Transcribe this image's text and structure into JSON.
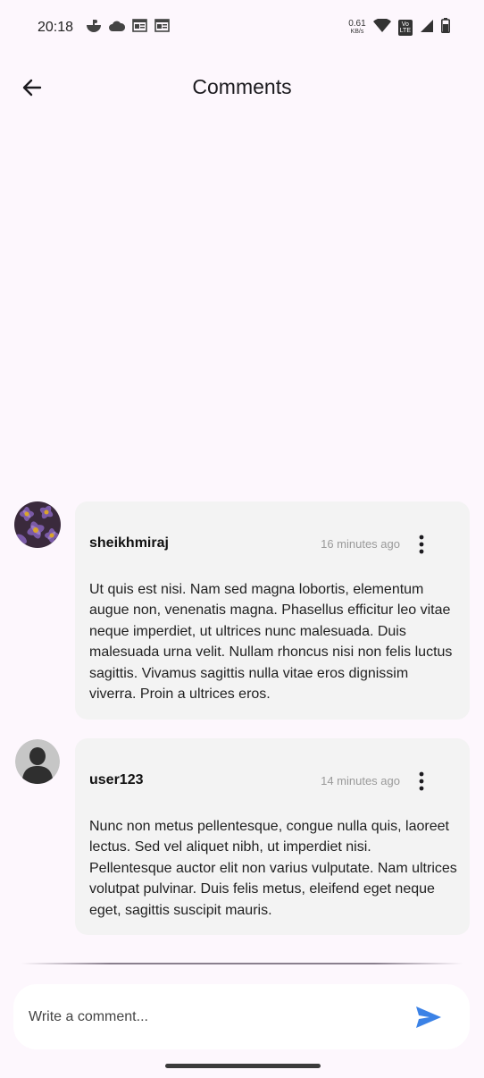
{
  "status_bar": {
    "time": "20:18",
    "net_speed_value": "0.61",
    "net_speed_unit": "KB/s",
    "volte_top": "Vo",
    "volte_bottom": "LTE",
    "icons": [
      "notification-icon",
      "cloud-icon",
      "news-icon",
      "news-icon",
      "wifi-icon",
      "volte-icon",
      "signal-icon",
      "battery-icon"
    ]
  },
  "app_bar": {
    "title": "Comments",
    "back_icon": "arrow-back-icon"
  },
  "comments": [
    {
      "username": "sheikhmiraj",
      "time_ago": "16 minutes ago",
      "text": "Ut quis est nisi. Nam sed magna lobortis, elementum augue non, venenatis magna. Phasellus efficitur leo vitae neque imperdiet, ut ultrices nunc malesuada. Duis malesuada urna velit. Nullam rhoncus nisi non felis luctus sagittis. Vivamus sagittis nulla vitae eros dignissim viverra. Proin a ultrices eros.",
      "avatar": "flower-photo"
    },
    {
      "username": "user123",
      "time_ago": "14 minutes ago",
      "text": "Nunc non metus pellentesque, congue nulla quis, laoreet lectus. Sed vel aliquet nibh, ut imperdiet nisi. Pellentesque auctor elit non varius vulputate. Nam ultrices volutpat pulvinar. Duis felis metus, eleifend eget neque eget, sagittis suscipit mauris.",
      "avatar": "default-person"
    }
  ],
  "composer": {
    "placeholder": "Write a comment...",
    "value": "",
    "send_icon": "send-icon",
    "send_color": "#3b82e6"
  }
}
